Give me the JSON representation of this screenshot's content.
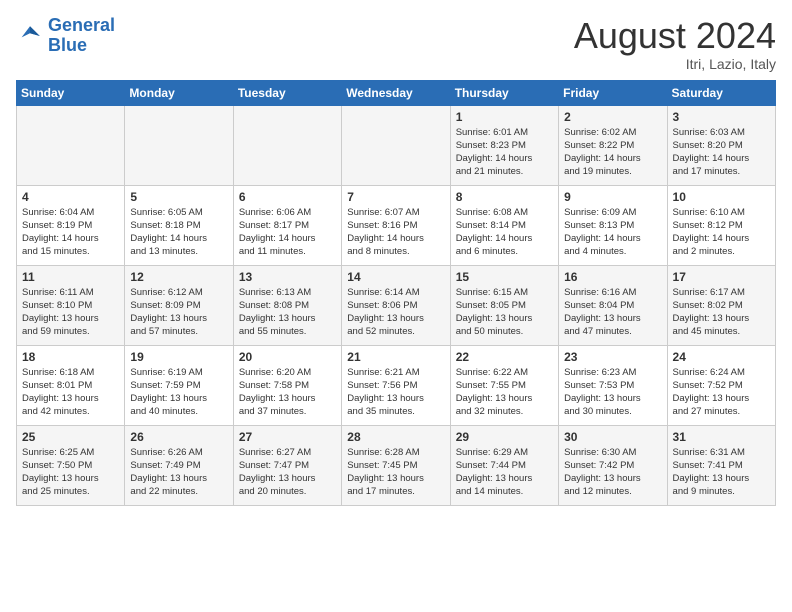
{
  "logo": {
    "text_general": "General",
    "text_blue": "Blue"
  },
  "title": "August 2024",
  "subtitle": "Itri, Lazio, Italy",
  "days_of_week": [
    "Sunday",
    "Monday",
    "Tuesday",
    "Wednesday",
    "Thursday",
    "Friday",
    "Saturday"
  ],
  "weeks": [
    [
      {
        "day": "",
        "info": ""
      },
      {
        "day": "",
        "info": ""
      },
      {
        "day": "",
        "info": ""
      },
      {
        "day": "",
        "info": ""
      },
      {
        "day": "1",
        "info": "Sunrise: 6:01 AM\nSunset: 8:23 PM\nDaylight: 14 hours\nand 21 minutes."
      },
      {
        "day": "2",
        "info": "Sunrise: 6:02 AM\nSunset: 8:22 PM\nDaylight: 14 hours\nand 19 minutes."
      },
      {
        "day": "3",
        "info": "Sunrise: 6:03 AM\nSunset: 8:20 PM\nDaylight: 14 hours\nand 17 minutes."
      }
    ],
    [
      {
        "day": "4",
        "info": "Sunrise: 6:04 AM\nSunset: 8:19 PM\nDaylight: 14 hours\nand 15 minutes."
      },
      {
        "day": "5",
        "info": "Sunrise: 6:05 AM\nSunset: 8:18 PM\nDaylight: 14 hours\nand 13 minutes."
      },
      {
        "day": "6",
        "info": "Sunrise: 6:06 AM\nSunset: 8:17 PM\nDaylight: 14 hours\nand 11 minutes."
      },
      {
        "day": "7",
        "info": "Sunrise: 6:07 AM\nSunset: 8:16 PM\nDaylight: 14 hours\nand 8 minutes."
      },
      {
        "day": "8",
        "info": "Sunrise: 6:08 AM\nSunset: 8:14 PM\nDaylight: 14 hours\nand 6 minutes."
      },
      {
        "day": "9",
        "info": "Sunrise: 6:09 AM\nSunset: 8:13 PM\nDaylight: 14 hours\nand 4 minutes."
      },
      {
        "day": "10",
        "info": "Sunrise: 6:10 AM\nSunset: 8:12 PM\nDaylight: 14 hours\nand 2 minutes."
      }
    ],
    [
      {
        "day": "11",
        "info": "Sunrise: 6:11 AM\nSunset: 8:10 PM\nDaylight: 13 hours\nand 59 minutes."
      },
      {
        "day": "12",
        "info": "Sunrise: 6:12 AM\nSunset: 8:09 PM\nDaylight: 13 hours\nand 57 minutes."
      },
      {
        "day": "13",
        "info": "Sunrise: 6:13 AM\nSunset: 8:08 PM\nDaylight: 13 hours\nand 55 minutes."
      },
      {
        "day": "14",
        "info": "Sunrise: 6:14 AM\nSunset: 8:06 PM\nDaylight: 13 hours\nand 52 minutes."
      },
      {
        "day": "15",
        "info": "Sunrise: 6:15 AM\nSunset: 8:05 PM\nDaylight: 13 hours\nand 50 minutes."
      },
      {
        "day": "16",
        "info": "Sunrise: 6:16 AM\nSunset: 8:04 PM\nDaylight: 13 hours\nand 47 minutes."
      },
      {
        "day": "17",
        "info": "Sunrise: 6:17 AM\nSunset: 8:02 PM\nDaylight: 13 hours\nand 45 minutes."
      }
    ],
    [
      {
        "day": "18",
        "info": "Sunrise: 6:18 AM\nSunset: 8:01 PM\nDaylight: 13 hours\nand 42 minutes."
      },
      {
        "day": "19",
        "info": "Sunrise: 6:19 AM\nSunset: 7:59 PM\nDaylight: 13 hours\nand 40 minutes."
      },
      {
        "day": "20",
        "info": "Sunrise: 6:20 AM\nSunset: 7:58 PM\nDaylight: 13 hours\nand 37 minutes."
      },
      {
        "day": "21",
        "info": "Sunrise: 6:21 AM\nSunset: 7:56 PM\nDaylight: 13 hours\nand 35 minutes."
      },
      {
        "day": "22",
        "info": "Sunrise: 6:22 AM\nSunset: 7:55 PM\nDaylight: 13 hours\nand 32 minutes."
      },
      {
        "day": "23",
        "info": "Sunrise: 6:23 AM\nSunset: 7:53 PM\nDaylight: 13 hours\nand 30 minutes."
      },
      {
        "day": "24",
        "info": "Sunrise: 6:24 AM\nSunset: 7:52 PM\nDaylight: 13 hours\nand 27 minutes."
      }
    ],
    [
      {
        "day": "25",
        "info": "Sunrise: 6:25 AM\nSunset: 7:50 PM\nDaylight: 13 hours\nand 25 minutes."
      },
      {
        "day": "26",
        "info": "Sunrise: 6:26 AM\nSunset: 7:49 PM\nDaylight: 13 hours\nand 22 minutes."
      },
      {
        "day": "27",
        "info": "Sunrise: 6:27 AM\nSunset: 7:47 PM\nDaylight: 13 hours\nand 20 minutes."
      },
      {
        "day": "28",
        "info": "Sunrise: 6:28 AM\nSunset: 7:45 PM\nDaylight: 13 hours\nand 17 minutes."
      },
      {
        "day": "29",
        "info": "Sunrise: 6:29 AM\nSunset: 7:44 PM\nDaylight: 13 hours\nand 14 minutes."
      },
      {
        "day": "30",
        "info": "Sunrise: 6:30 AM\nSunset: 7:42 PM\nDaylight: 13 hours\nand 12 minutes."
      },
      {
        "day": "31",
        "info": "Sunrise: 6:31 AM\nSunset: 7:41 PM\nDaylight: 13 hours\nand 9 minutes."
      }
    ]
  ]
}
